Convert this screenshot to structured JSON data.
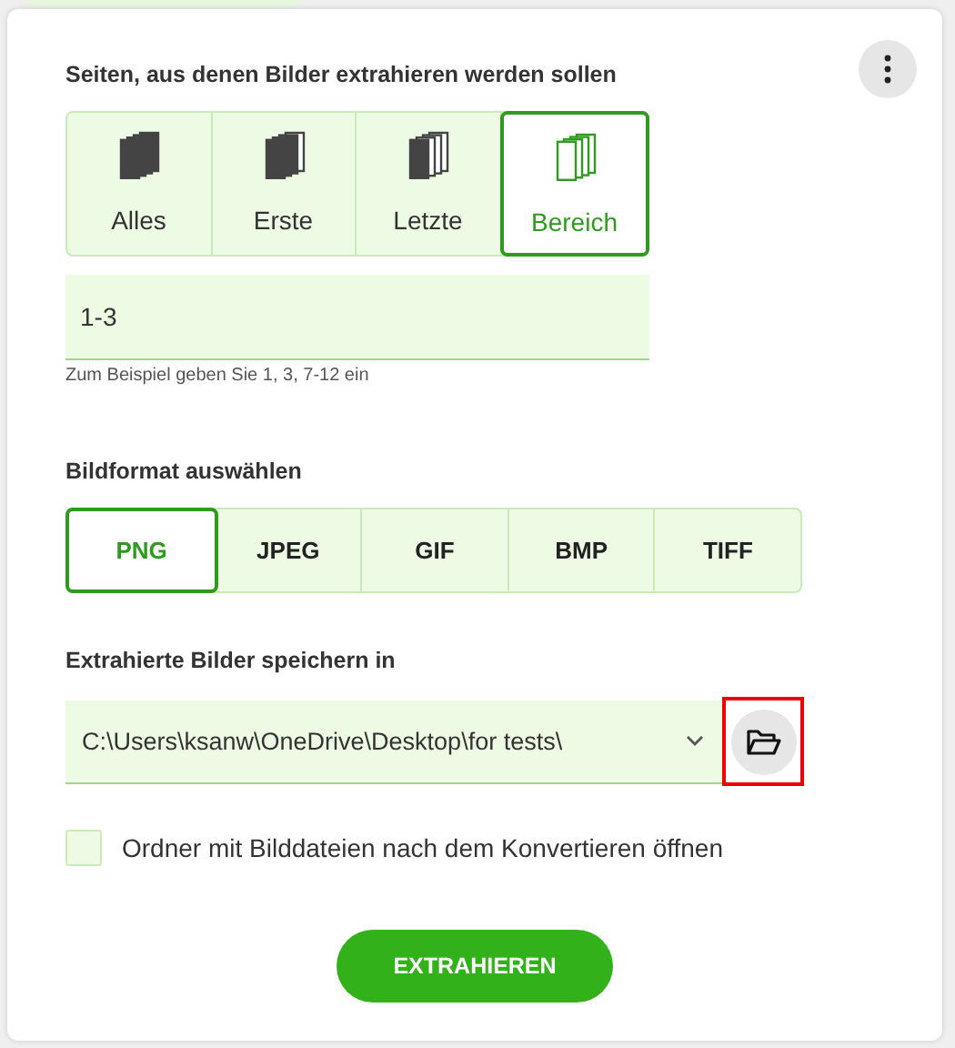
{
  "pages": {
    "label": "Seiten, aus denen Bilder extrahieren werden sollen",
    "options": [
      {
        "kind": "all",
        "label": "Alles",
        "selected": false
      },
      {
        "kind": "first",
        "label": "Erste",
        "selected": false
      },
      {
        "kind": "last",
        "label": "Letzte",
        "selected": false
      },
      {
        "kind": "range",
        "label": "Bereich",
        "selected": true
      }
    ],
    "range": {
      "value": "1-3"
    },
    "hint": "Zum Beispiel geben Sie 1, 3, 7-12 ein"
  },
  "format": {
    "label": "Bildformat auswählen",
    "options": [
      {
        "label": "PNG",
        "selected": true
      },
      {
        "label": "JPEG",
        "selected": false
      },
      {
        "label": "GIF",
        "selected": false
      },
      {
        "label": "BMP",
        "selected": false
      },
      {
        "label": "TIFF",
        "selected": false
      }
    ]
  },
  "output": {
    "label": "Extrahierte Bilder speichern in",
    "path": "C:\\Users\\ksanw\\OneDrive\\Desktop\\for tests\\",
    "browse_highlighted": true
  },
  "open_folder": {
    "label": "Ordner mit Bilddateien nach dem Konvertieren öffnen",
    "checked": false
  },
  "extract_button": "EXTRAHIEREN"
}
